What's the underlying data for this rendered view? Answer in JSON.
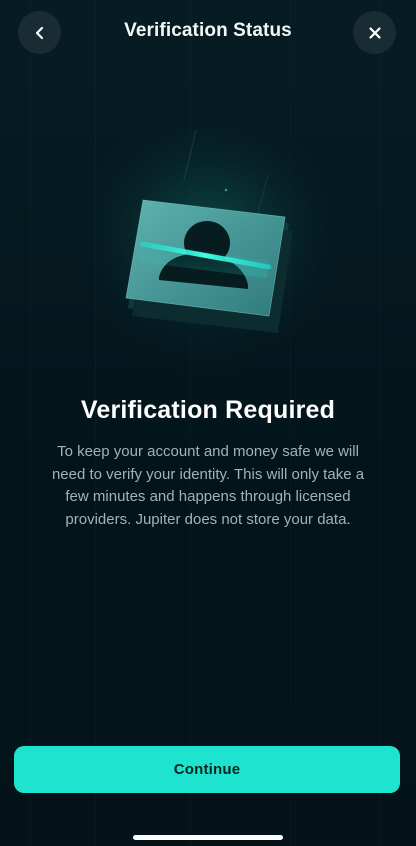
{
  "header": {
    "title": "Verification Status",
    "back_icon": "chevron-left-icon",
    "close_icon": "close-icon"
  },
  "hero": {
    "icon": "id-card-scan-illustration"
  },
  "content": {
    "headline": "Verification Required",
    "body": "To keep your account and money safe we will need to verify your identity. This will only take a few minutes and happens through licensed providers. Jupiter does not store your data."
  },
  "actions": {
    "continue_label": "Continue"
  },
  "colors": {
    "background": "#03161d",
    "accent": "#1de3cf",
    "button_text": "#05251f",
    "body_text": "#a3b2b7"
  }
}
